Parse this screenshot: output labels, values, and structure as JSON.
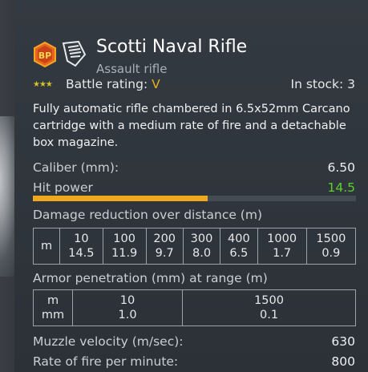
{
  "weapon": {
    "name": "Scotti Naval Rifle",
    "type": "Assault rifle",
    "battle_rating_label": "Battle rating:",
    "battle_rating_value": "V",
    "stars": "★★★",
    "stock_label": "In stock: 3",
    "description": "Fully automatic rifle chambered in 6.5x52mm Carcano cartridge with a medium rate of fire and a detachable box magazine."
  },
  "badges": {
    "tier_icon": "bp-badge-icon",
    "class_icon": "hand-rifle-class-icon"
  },
  "stats": {
    "caliber_label": "Caliber (mm):",
    "caliber_value": "6.50",
    "hit_power_label": "Hit power",
    "hit_power_value": "14.5",
    "hit_power_fraction": 0.54
  },
  "damage_reduction": {
    "title": "Damage reduction over distance (m)",
    "row_header": "m",
    "distances": [
      "10",
      "100",
      "200",
      "300",
      "400",
      "1000",
      "1500"
    ],
    "values": [
      "14.5",
      "11.9",
      "9.7",
      "8.0",
      "6.5",
      "1.7",
      "0.9"
    ]
  },
  "armor_penetration": {
    "title": "Armor penetration (mm) at range (m)",
    "row_header_top": "m",
    "row_header_bottom": "mm",
    "ranges": [
      "10",
      "1500"
    ],
    "values": [
      "1.0",
      "0.1"
    ]
  },
  "footer_stats": {
    "muzzle_label": "Muzzle velocity (m/sec):",
    "muzzle_value": "630",
    "rof_label": "Rate of fire per minute:",
    "rof_value": "800"
  },
  "colors": {
    "accent_orange": "#f0a91c",
    "green_value": "#5cd02a",
    "rating_gold": "#e8b01c"
  }
}
